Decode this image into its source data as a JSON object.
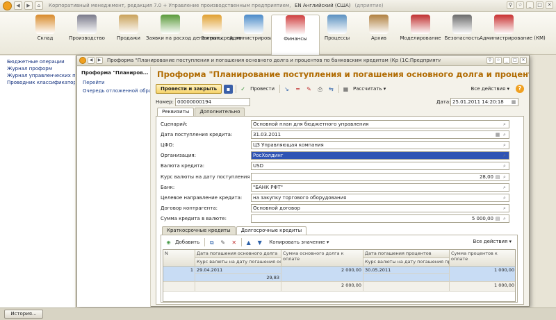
{
  "app": {
    "title": "Корпоративный менеджмент, редакция 7.0 + Управление производственным предприятием, редакция 1.3 /",
    "lang": "EN Английский (США)",
    "tail": "(дприятие)"
  },
  "sections": [
    {
      "label": "Склад",
      "icon": "warehouse-icon",
      "color": "#d88a2a"
    },
    {
      "label": "Производство",
      "icon": "factory-icon",
      "color": "#7a7a8a"
    },
    {
      "label": "Продажи",
      "icon": "sales-icon",
      "color": "#c9a25a"
    },
    {
      "label": "Заявки на расход денежных средств",
      "icon": "request-icon",
      "color": "#5a9a3a"
    },
    {
      "label": "Затраты",
      "icon": "costs-icon",
      "color": "#e0a030"
    },
    {
      "label": "Администрирование",
      "icon": "admin-icon",
      "color": "#4a8ac8"
    },
    {
      "label": "Финансы",
      "icon": "finance-icon",
      "color": "#d04040"
    },
    {
      "label": "Процессы",
      "icon": "processes-icon",
      "color": "#5a90c0"
    },
    {
      "label": "Архив",
      "icon": "archive-icon",
      "color": "#b08040"
    },
    {
      "label": "Моделирование",
      "icon": "modeling-icon",
      "color": "#c03030"
    },
    {
      "label": "Безопасность",
      "icon": "security-icon",
      "color": "#6a6a6a"
    },
    {
      "label": "Администрирование (КМ)",
      "icon": "admin-km-icon",
      "color": "#c83030"
    }
  ],
  "leftnav": [
    "Бюджетные операции",
    "Журнал проформ",
    "Журнал управленческих провод",
    "Проводник классификаторов"
  ],
  "history_label": "История...",
  "form": {
    "caption": "Проформа \"Планирование поступления и погашения основного долга и процентов по банковским кредитам (Кр (1С:Предприятие)",
    "side_title": "Проформа \"Планиров...",
    "side_links": [
      "Перейти",
      "Очередь отложенной обра..."
    ],
    "doc_title": "Проформа \"Планирование поступления и погашения основного долга и процентов по банковским...",
    "post_close": "Провести и закрыть",
    "post": "Провести",
    "calc": "Рассчитать",
    "all_actions": "Все действия",
    "number_label": "Номер:",
    "number": "00000000194",
    "date_label": "Дата:",
    "date": "25.01.2011 14:20:18",
    "tabs": [
      "Реквизиты",
      "Дополнительно"
    ],
    "fields": [
      {
        "label": "Сценарий:",
        "value": "Основной план для бюджетного управления"
      },
      {
        "label": "Дата поступления кредита:",
        "value": "31.03.2011"
      },
      {
        "label": "ЦФО:",
        "value": "ЦЗ Управляющая компания"
      },
      {
        "label": "Организация:",
        "value": "РосХолдинг"
      },
      {
        "label": "Валюта кредита:",
        "value": "USD"
      },
      {
        "label": "Курс валюты на дату поступления кредита:",
        "value": "28,00"
      },
      {
        "label": "Банк:",
        "value": "\"БАНК РФТ\""
      },
      {
        "label": "Целевое направление кредита:",
        "value": "на закупку торгового оборудования"
      },
      {
        "label": "Договор контрагента:",
        "value": "Основной договор"
      },
      {
        "label": "Сумма кредита в валюте:",
        "value": "5 000,00"
      }
    ],
    "inner_tabs": [
      "Краткосрочные кредиты",
      "Долгосрочные кредиты"
    ],
    "table": {
      "add": "Добавить",
      "copy_value": "Копировать значение",
      "all_actions": "Все действия",
      "headers": {
        "n": "N",
        "c1a": "Дата погашения основного долга",
        "c1b": "Курс валюты на дату погашения основно...",
        "c2": "Сумма основного долга к оплате",
        "c3a": "Дата погашения процентов",
        "c3b": "Курс валюты на дату погашения процентов",
        "c4": "Сумма процентов к оплате"
      },
      "rows": [
        {
          "n": "1",
          "c1a": "29.04.2011",
          "c1b": "29,83",
          "c2": "2 000,00",
          "c3a": "30.05.2011",
          "c3b": "",
          "c4": "1 000,00"
        }
      ],
      "totals": {
        "c2": "2 000,00",
        "c4": "1 000,00"
      }
    }
  }
}
